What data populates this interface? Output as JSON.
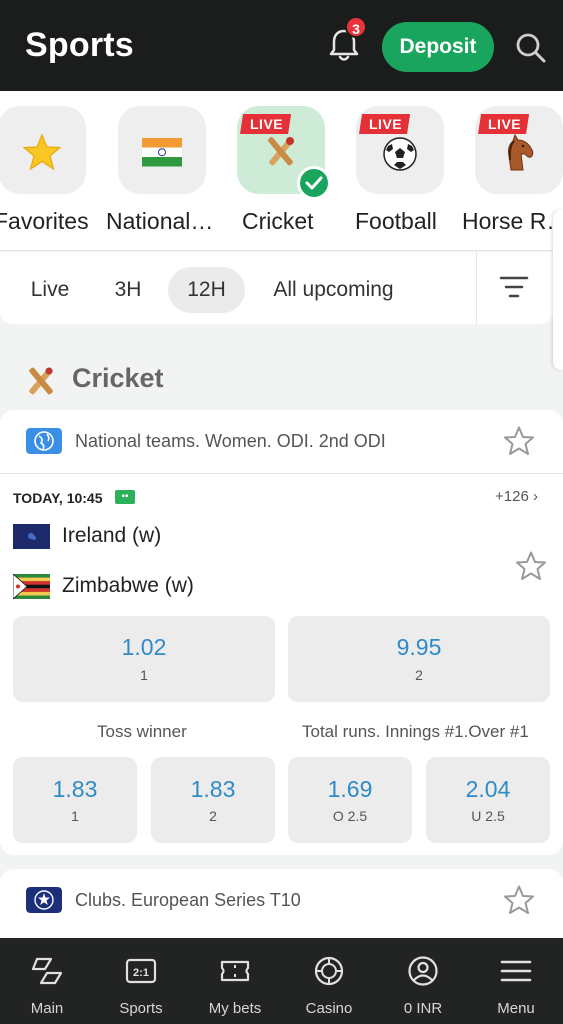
{
  "header": {
    "title": "Sports",
    "notification_count": "3",
    "deposit_label": "Deposit"
  },
  "categories": [
    {
      "label": "Favorites",
      "icon": "star-icon",
      "live": false
    },
    {
      "label": "National…",
      "icon": "india-flag-icon",
      "live": false
    },
    {
      "label": "Cricket",
      "icon": "cricket-icon",
      "live": true,
      "live_label": "LIVE",
      "selected": true
    },
    {
      "label": "Football",
      "icon": "football-icon",
      "live": true,
      "live_label": "LIVE"
    },
    {
      "label": "Horse R…",
      "icon": "horse-icon",
      "live": true,
      "live_label": "LIVE"
    }
  ],
  "time_filters": [
    {
      "label": "Live"
    },
    {
      "label": "3H"
    },
    {
      "label": "12H",
      "active": true
    },
    {
      "label": "All upcoming"
    }
  ],
  "section": {
    "title": "Cricket"
  },
  "league1": {
    "name": "National teams. Women. ODI. 2nd ODI",
    "match": {
      "time": "TODAY, 10:45",
      "more_markets": "+126 ›",
      "team1": "Ireland (w)",
      "team2": "Zimbabwe (w)",
      "main_odds": [
        {
          "value": "1.02",
          "label": "1"
        },
        {
          "value": "9.95",
          "label": "2"
        }
      ],
      "market_a": {
        "title": "Toss winner",
        "odds": [
          {
            "value": "1.83",
            "label": "1"
          },
          {
            "value": "1.83",
            "label": "2"
          }
        ]
      },
      "market_b": {
        "title": "Total runs. Innings #1.Over #1",
        "odds": [
          {
            "value": "1.69",
            "label": "O 2.5"
          },
          {
            "value": "2.04",
            "label": "U 2.5"
          }
        ]
      }
    }
  },
  "league2": {
    "name": "Clubs. European Series T10"
  },
  "bottom_nav": [
    {
      "label": "Main",
      "icon": "main-icon"
    },
    {
      "label": "Sports",
      "icon": "scoreboard-icon"
    },
    {
      "label": "My bets",
      "icon": "ticket-icon"
    },
    {
      "label": "Casino",
      "icon": "chip-icon"
    },
    {
      "label": "0 INR",
      "icon": "account-icon"
    },
    {
      "label": "Menu",
      "icon": "menu-icon"
    }
  ],
  "colors": {
    "header_bg": "#1b1c1c",
    "deposit_green": "#1aa55f",
    "live_red": "#e43036",
    "odds_blue": "#2f8ac8",
    "badge_red": "#e8333a"
  }
}
